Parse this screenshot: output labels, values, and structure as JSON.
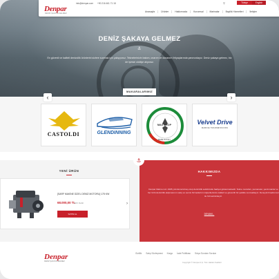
{
  "header": {
    "logo": "Denpar",
    "logo_tagline": "DENİZ ŞAKAYA GELMEZ",
    "email": "info@denpar.com",
    "phone": "+90 216 461 71 18",
    "lang_tr": "Türkçe",
    "lang_en": "English",
    "nav": [
      "Anasayfa",
      "Ürünler",
      "Hakkımızda",
      "Kurumsal",
      "Marinalar",
      "Bayilik Hizmetleri",
      "İletişim"
    ]
  },
  "hero": {
    "title": "DENİZ ŞAKAYA GELMEZ",
    "description": "En güvenli ve kaliteli denizcilik ürünlerini sizlere sunmak için çalışıyoruz. Teknelerinizin bakım, onarım ve donanım ihtiyaçlarında yanınızdayız. Deniz şakaya gelmez, biz de işimizi ciddiye alıyoruz."
  },
  "brands": {
    "title": "MAKARALARIMIZ",
    "items": [
      {
        "name": "CASTOLDI"
      },
      {
        "name": "GLENDINNING"
      },
      {
        "name": "MAX PROP",
        "caption": "MADE IN ITALY"
      },
      {
        "name": "Velvet Drive",
        "caption": "MARINE TRANSMISSIONS"
      }
    ]
  },
  "new_product": {
    "title": "YENİ ÜRÜN",
    "product_title": "[SARF MAKİNE DİZEL DENİZ MOTORU] 175 KW",
    "price": "68.000,00 TL",
    "vat": "KDV Dahil",
    "buy_label": "SATIN AL"
  },
  "about": {
    "title": "HAKKIMIZDA",
    "text": "Denpar Marine Ltd. 1995 yılında kurulmuş olup denizcilik sektöründe faaliyet göstermektedir. Tekne motorları, pervaneler, şanzımanlar ve her türlü denizcilik ekipmanının satış ve servis hizmetlerini müşterilerimize kaliteli ve güvenilir bir şekilde sunmaktayız. Deneyimli kadromuz ile hizmetinizdeyiz.",
    "more": "DEVAMI..."
  },
  "footer": {
    "logo": "Denpar",
    "logo_tagline": "DENİZ ŞAKAYA GELMEZ",
    "links": [
      "Gizlilik",
      "Satış Sözleşmesi",
      "Kargo",
      "İade Politikası",
      "Sıkça Sorulan Sorular"
    ],
    "copyright": "Copyright © Denpar A.Ş. Tüm Hakları Saklıdır."
  },
  "colors": {
    "brand_red": "#c8202a",
    "about_bg": "#c9343a"
  }
}
